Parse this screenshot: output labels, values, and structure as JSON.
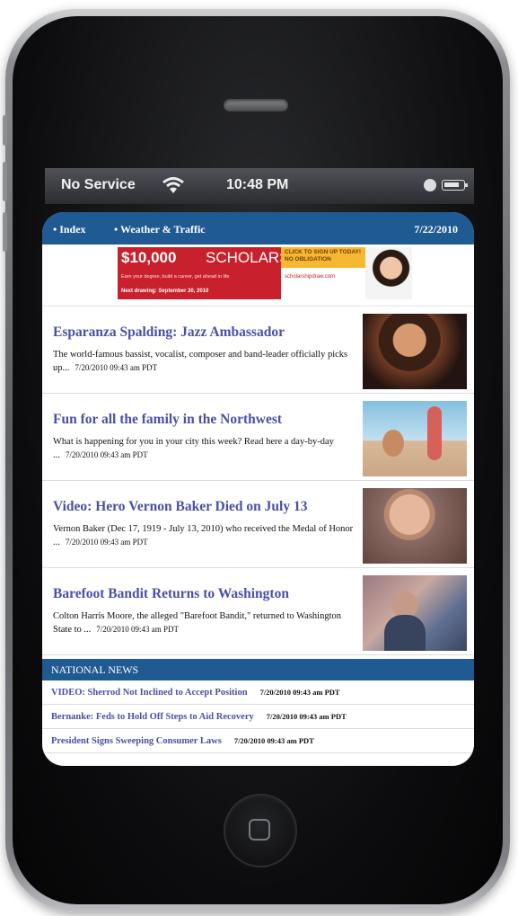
{
  "status_bar": {
    "carrier": "No Service",
    "time": "10:48 PM"
  },
  "nav": {
    "index": "• Index",
    "weather": "• Weather & Traffic",
    "date": "7/22/2010"
  },
  "ad": {
    "amount": "$10,000",
    "word": "SCHOLARSHIP",
    "subtext": "Earn your degree, build a career, get ahead in life",
    "deadline": "Next drawing: September 30, 2010",
    "cta": "CLICK TO SIGN UP TODAY! NO OBLIGATION",
    "site": "scholarshipdraw.com"
  },
  "articles": [
    {
      "title": "Esparanza Spalding: Jazz Ambassador",
      "desc": "The world-famous bassist, vocalist, composer and band-leader officially picks up...",
      "time": "7/20/2010 09:43 am PDT"
    },
    {
      "title": "Fun for all the family in the Northwest",
      "desc": "What is happening for you in your city this week? Read here a day-by-day ...",
      "time": "7/20/2010 09:43 am PDT"
    },
    {
      "title": "Video: Hero Vernon Baker Died on July 13",
      "desc": "Vernon Baker (Dec 17, 1919 - July 13, 2010) who received the Medal of Honor ...",
      "time": "7/20/2010 09:43 am PDT"
    },
    {
      "title": "Barefoot Bandit Returns to Washington",
      "desc": "Colton Harris Moore, the alleged \"Barefoot Bandit,\" returned to Washington State to ...",
      "time": "7/20/2010 09:43 am PDT"
    }
  ],
  "national_news": {
    "header": "NATIONAL NEWS",
    "items": [
      {
        "title": "VIDEO: Sherrod Not Inclined to Accept Position",
        "time": "7/20/2010 09:43 am PDT"
      },
      {
        "title": "Bernanke: Feds to Hold Off Steps to Aid Recovery",
        "time": "7/20/2010 09:43 am PDT"
      },
      {
        "title": "President Signs Sweeping Consumer Laws",
        "time": "7/20/2010 09:43 am PDT"
      }
    ]
  },
  "colors": {
    "nav_blue": "#1f5a92",
    "headline_purple": "#4b4fa3",
    "ad_red": "#c8202c",
    "ad_yellow": "#f6b833"
  },
  "icons": [
    "wifi-icon",
    "lock-icon",
    "battery-icon",
    "home-button-icon"
  ]
}
